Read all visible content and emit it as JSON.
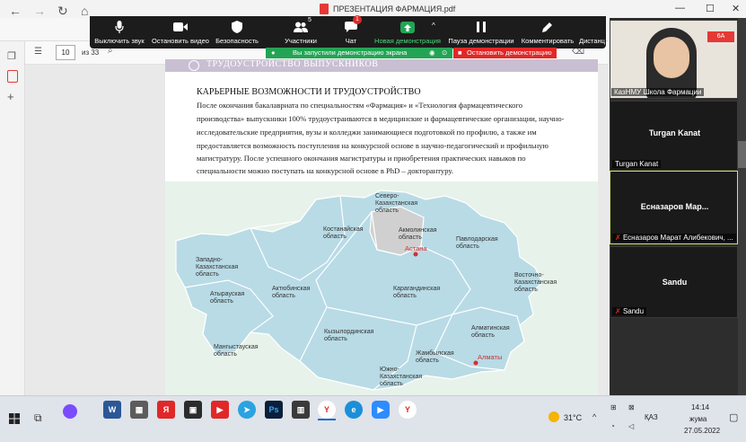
{
  "browser": {
    "tab_title": "ПРЕЗЕНТАЦИЯ ФАРМАЦИЯ.pdf",
    "page_current": "10",
    "page_total": "из 33"
  },
  "zoom_toolbar": {
    "mute": "Выключить звук",
    "stop_video": "Остановить видео",
    "security": "Безопасность",
    "participants": "Участники",
    "participants_count": "5",
    "chat": "Чат",
    "chat_badge": "1",
    "new_share": "Новая демонстрация",
    "pause_share": "Пауза демонстрации",
    "annotate": "Комментировать",
    "more": "Дистанц",
    "share_banner": "Вы запустили демонстрацию экрана",
    "stop_share": "Остановить демонстрацию"
  },
  "slide": {
    "banner": "ТРУДОУСТРОЙСТВО ВЫПУСКНИКОВ",
    "heading": "КАРЬЕРНЫЕ ВОЗМОЖНОСТИ И ТРУДОУСТРОЙСТВО",
    "paragraph_lines": [
      "После окончания бакалавриата по специальностям «Фармация» и «Технология фармацевтического",
      "производства» выпускники 100% трудоустраиваются в медицинские и фармацевтические организации, научно-",
      "исследовательские предприятия, вузы и колледжи занимающиеся подготовкой по профилю, а также им",
      "предоставляется возможность поступления на конкурсной основе в научно-педагогический и профильную",
      "магистратуру. После успешного окончания магистратуры и приобретения практических навыков по",
      "специальности можно поступать на конкурсной основе в PhD – докторантуру."
    ],
    "map": {
      "regions": {
        "north_kaz": "Северо-Казахстанская область",
        "kostanay": "Костанайская область",
        "akmola": "Акмолинская область",
        "pavlodar": "Павлодарская область",
        "west_kaz": "Западно-Казахстанская область",
        "atyrau": "Атырауская область",
        "aktobe": "Актюбинская область",
        "karaganda": "Карагандинская область",
        "east_kaz": "Восточно-Казахстанская область",
        "mangystau": "Мангыстауская область",
        "kyzylorda": "Кызылординская область",
        "almaty": "Алматинская область",
        "zhambyl": "Жамбылская область",
        "south_kaz": "Южно-Казахстанская область"
      },
      "cities": {
        "astana": "Астана",
        "almaty": "Алматы"
      }
    }
  },
  "participants": [
    {
      "name": "КазНМУ Школа Фармации",
      "has_video": true
    },
    {
      "name": "Turgan Kanat",
      "label": "Turgan Kanat"
    },
    {
      "name": "Есназаров Мар...",
      "label": "Есназаров Марат Алибекович, ..."
    },
    {
      "name": "Sandu",
      "label": "Sandu"
    }
  ],
  "taskbar": {
    "temperature": "31°C",
    "language": "ҚАЗ",
    "time": "14:14",
    "day": "жума",
    "date": "27.05.2022"
  }
}
